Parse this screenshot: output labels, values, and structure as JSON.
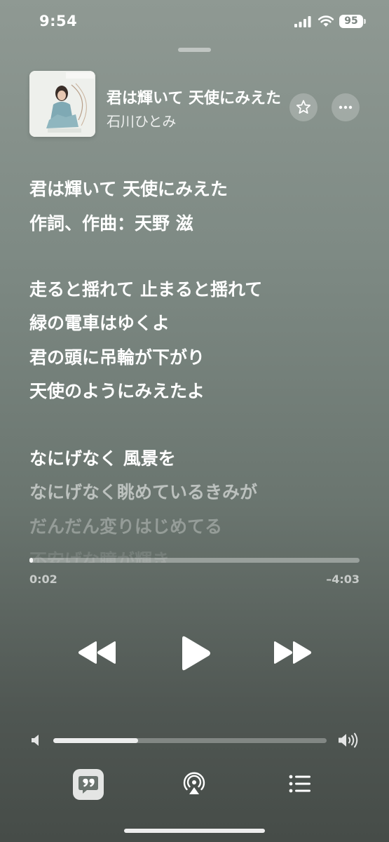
{
  "status_bar": {
    "time": "9:54",
    "battery": "95"
  },
  "now_playing": {
    "title": "君は輝いて 天使にみえた",
    "artist": "石川ひとみ",
    "album_art": "album-artwork"
  },
  "lyrics": [
    "君は輝いて 天使にみえた",
    "作詞、作曲：天野 滋",
    "走ると揺れて 止まると揺れて",
    "緑の電車はゆくよ",
    "君の頭に吊輪が下がり",
    "天使のようにみえたよ",
    "なにげなく 風景を",
    "なにげなく眺めているきみが",
    "だんだん変りはじめてる",
    "不安げな瞳が輝き"
  ],
  "playback": {
    "elapsed": "0:02",
    "remaining": "–4:03",
    "progress_fraction": 0.008
  },
  "volume": {
    "level_fraction": 0.31
  },
  "icons": {
    "favorite": "star-icon",
    "more": "more-icon",
    "rewind": "rewind-icon",
    "play": "play-icon",
    "forward": "fast-forward-icon",
    "volume_low": "volume-low-icon",
    "volume_high": "volume-high-icon",
    "lyrics": "lyrics-icon",
    "airplay": "airplay-icon",
    "queue": "queue-icon"
  }
}
